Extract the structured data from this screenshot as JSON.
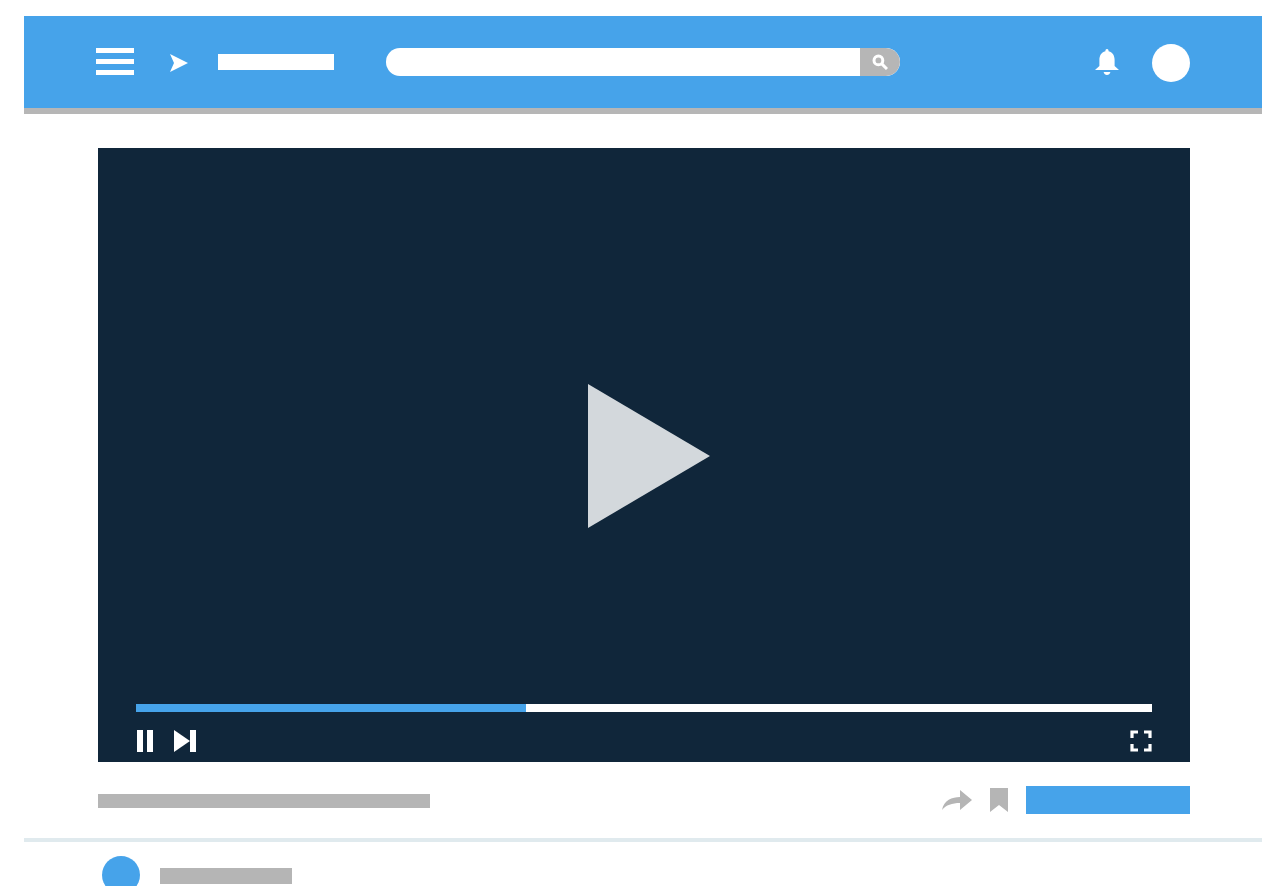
{
  "player": {
    "progress": {
      "level": 0.384
    }
  }
}
